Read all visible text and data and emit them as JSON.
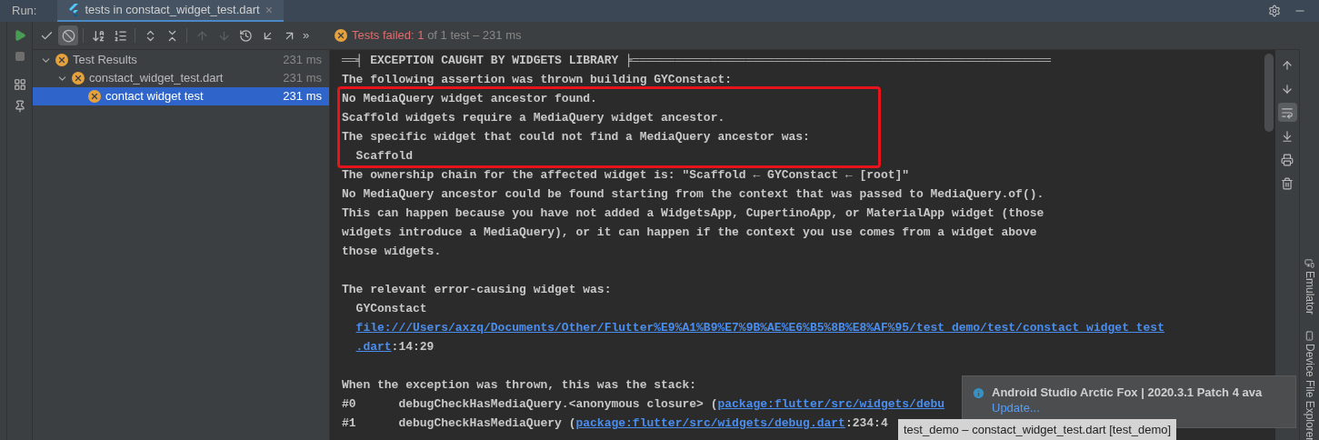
{
  "run_bar": {
    "label": "Run:",
    "tab": {
      "title": "tests in constact_widget_test.dart",
      "selected": true,
      "close": "×"
    }
  },
  "toolbar": [
    {
      "kind": "check",
      "on": false,
      "disabled": false
    },
    {
      "kind": "ignored",
      "on": true,
      "disabled": false
    },
    {
      "kind": "sort-alpha",
      "on": false,
      "disabled": false
    },
    {
      "kind": "sort-duration",
      "on": false,
      "disabled": false
    },
    {
      "kind": "expand",
      "on": false,
      "disabled": false
    },
    {
      "kind": "collapse",
      "on": false,
      "disabled": false
    },
    {
      "kind": "up",
      "on": false,
      "disabled": true
    },
    {
      "kind": "down",
      "on": false,
      "disabled": true
    },
    {
      "kind": "history",
      "on": false,
      "disabled": false
    },
    {
      "kind": "import",
      "on": false,
      "disabled": false
    },
    {
      "kind": "export",
      "on": false,
      "disabled": false
    }
  ],
  "toolbar_more": "»",
  "status": {
    "failed": "Tests failed: 1",
    "rest": "of 1 test – 231 ms"
  },
  "tests": [
    {
      "name": "Test Results",
      "time": "231 ms",
      "expanded": true,
      "selected": false,
      "children": [
        {
          "name": "constact_widget_test.dart",
          "time": "231 ms",
          "expanded": true,
          "selected": false,
          "children": [
            {
              "name": "contact widget test",
              "time": "231 ms",
              "selected": true
            }
          ]
        }
      ]
    }
  ],
  "console": [
    {
      "groups": [
        {
          "lines": [
            {
              "segments": [
                {
                  "text": "══╡ EXCEPTION CAUGHT BY WIDGETS LIBRARY ╞═══════════════════════════════════════════════════════════"
                }
              ]
            },
            {
              "segments": [
                {
                  "text": "The following assertion was thrown building GYConstact:"
                }
              ]
            }
          ]
        },
        {
          "highlighted": true,
          "lines": [
            {
              "segments": [
                {
                  "text": "No MediaQuery widget ancestor found."
                }
              ]
            },
            {
              "segments": [
                {
                  "text": "Scaffold widgets require a MediaQuery widget ancestor."
                }
              ]
            },
            {
              "segments": [
                {
                  "text": "The specific widget that could not find a MediaQuery ancestor was:"
                }
              ]
            },
            {
              "indented": true,
              "segments": [
                {
                  "text": "Scaffold"
                }
              ]
            }
          ]
        },
        {
          "lines": [
            {
              "segments": [
                {
                  "text": "The ownership chain for the affected widget is: \"Scaffold ← GYConstact ← [root]\""
                }
              ]
            },
            {
              "segments": [
                {
                  "text": "No MediaQuery ancestor could be found starting from the context that was passed to MediaQuery.of()."
                }
              ]
            },
            {
              "segments": [
                {
                  "text": "This can happen because you have not added a WidgetsApp, CupertinoApp, or MaterialApp widget (those"
                }
              ]
            },
            {
              "segments": [
                {
                  "text": "widgets introduce a MediaQuery), or it can happen if the context you use comes from a widget above"
                }
              ]
            },
            {
              "segments": [
                {
                  "text": "those widgets."
                }
              ]
            }
          ]
        }
      ]
    },
    {
      "groups": [
        {
          "lines": [
            {
              "segments": [
                {
                  "text": "The relevant error-causing widget was:"
                }
              ]
            },
            {
              "indented": true,
              "segments": [
                {
                  "text": "GYConstact"
                }
              ]
            },
            {
              "indented": true,
              "segments": [
                {
                  "text": "file:///Users/axzq/Documents/Other/Flutter%E9%A1%B9%E7%9B%AE%E6%B5%8B%E8%AF%95/test_demo/test/constact_widget_test",
                  "link": true
                }
              ]
            },
            {
              "indented": true,
              "segments": [
                {
                  "text": ".dart",
                  "link": true
                },
                {
                  "text": ":14:29"
                }
              ]
            }
          ]
        }
      ]
    },
    {
      "groups": [
        {
          "lines": [
            {
              "segments": [
                {
                  "text": "When the exception was thrown, this was the stack:"
                }
              ]
            },
            {
              "segments": [
                {
                  "text": "#0      debugCheckHasMediaQuery.<anonymous closure> ("
                },
                {
                  "text": "package:flutter/src/widgets/debu",
                  "link": true
                }
              ]
            },
            {
              "segments": [
                {
                  "text": "#1      debugCheckHasMediaQuery ("
                },
                {
                  "text": "package:flutter/src/widgets/debug.dart",
                  "link": true
                },
                {
                  "text": ":234:4"
                }
              ]
            }
          ]
        }
      ]
    }
  ],
  "side_tools": [
    {
      "kind": "up",
      "on": false
    },
    {
      "kind": "down",
      "on": false
    },
    {
      "kind": "wrap",
      "on": true
    },
    {
      "kind": "scroll-end",
      "on": false
    },
    {
      "kind": "print",
      "on": false
    },
    {
      "kind": "trash",
      "on": false
    }
  ],
  "right_strip": [
    "Emulator",
    "Device File Explorer"
  ],
  "notification": {
    "title": "Android Studio Arctic Fox | 2020.3.1 Patch 4 ava",
    "action": "Update..."
  },
  "tooltip": "test_demo – constact_widget_test.dart [test_demo]"
}
